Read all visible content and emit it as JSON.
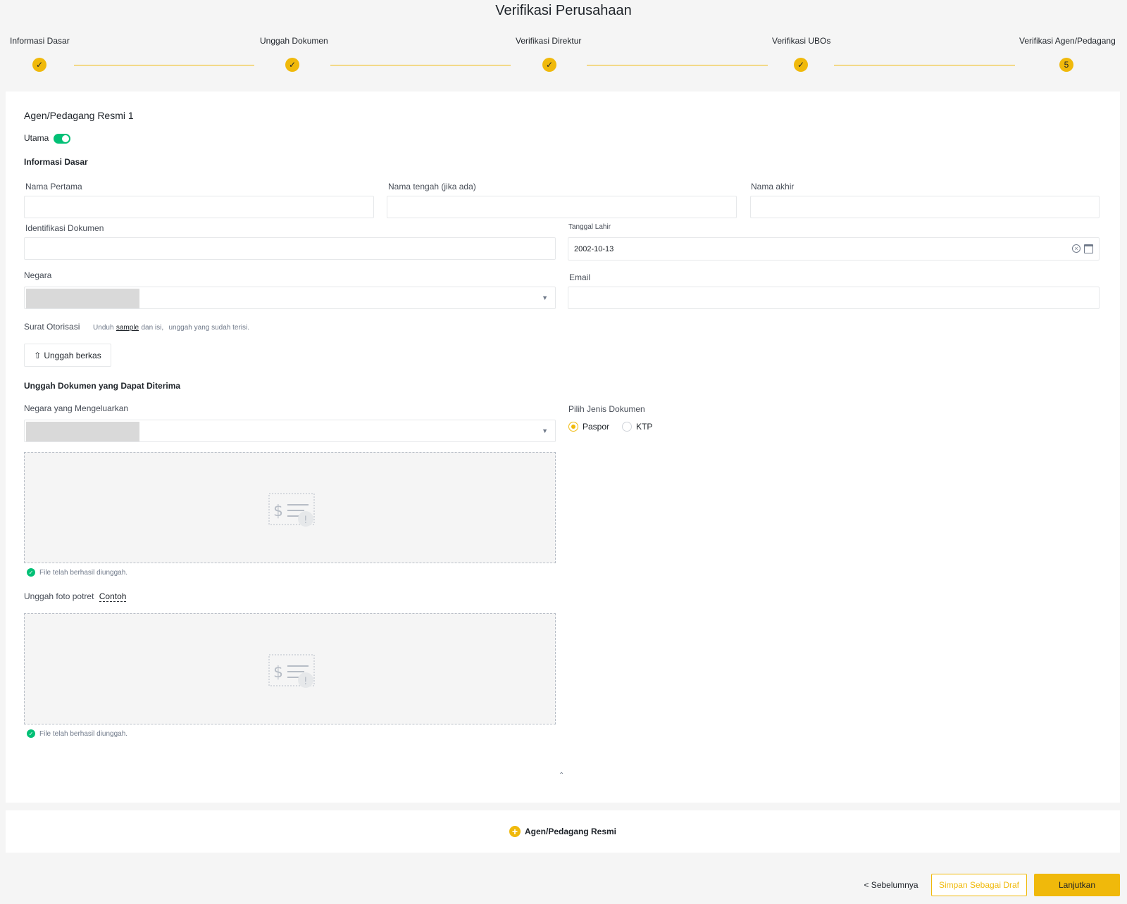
{
  "page": {
    "title": "Verifikasi Perusahaan"
  },
  "stepper": {
    "steps": [
      {
        "label": "Informasi Dasar",
        "status": "done",
        "badge": "✓"
      },
      {
        "label": "Unggah Dokumen",
        "status": "done",
        "badge": "✓"
      },
      {
        "label": "Verifikasi Direktur",
        "status": "done",
        "badge": "✓"
      },
      {
        "label": "Verifikasi UBOs",
        "status": "done",
        "badge": "✓"
      },
      {
        "label": "Verifikasi Agen/Pedagang",
        "status": "current",
        "badge": "5"
      }
    ],
    "accent_color": "#f0b90b"
  },
  "agent": {
    "title": "Agen/Pedagang Resmi 1",
    "primary_label": "Utama",
    "primary_on": true,
    "basic_info_title": "Informasi Dasar",
    "first_name": {
      "label": "Nama Pertama",
      "value": ""
    },
    "middle_name": {
      "label": "Nama tengah (jika ada)",
      "value": ""
    },
    "last_name": {
      "label": "Nama akhir",
      "value": ""
    },
    "id_document": {
      "label": "Identifikasi Dokumen",
      "value": ""
    },
    "birth_date": {
      "label": "Tanggal Lahir",
      "value": "2002-10-13"
    },
    "country": {
      "label": "Negara"
    },
    "email": {
      "label": "Email",
      "value": ""
    },
    "authorization": {
      "label": "Surat Otorisasi",
      "hint_prefix": "Unduh",
      "hint_link": "sample",
      "hint_middle": "dan isi,",
      "hint_suffix": "unggah yang sudah terisi.",
      "upload_button": "Unggah berkas"
    },
    "documents_title": "Unggah Dokumen yang Dapat Diterima",
    "issuing_country": {
      "label": "Negara yang Mengeluarkan"
    },
    "document_type": {
      "label": "Pilih Jenis Dokumen",
      "options": [
        "Paspor",
        "KTP"
      ],
      "selected": "Paspor"
    },
    "upload_success": "File telah berhasil diunggah.",
    "portrait": {
      "label": "Unggah foto potret",
      "example_link": "Contoh"
    }
  },
  "add_agent_label": "Agen/Pedagang Resmi",
  "footer": {
    "prev_label": "< Sebelumnya",
    "draft_label": "Simpan Sebagai Draf",
    "next_label": "Lanjutkan"
  },
  "colors": {
    "accent": "#f0b90b",
    "success": "#02c076"
  }
}
